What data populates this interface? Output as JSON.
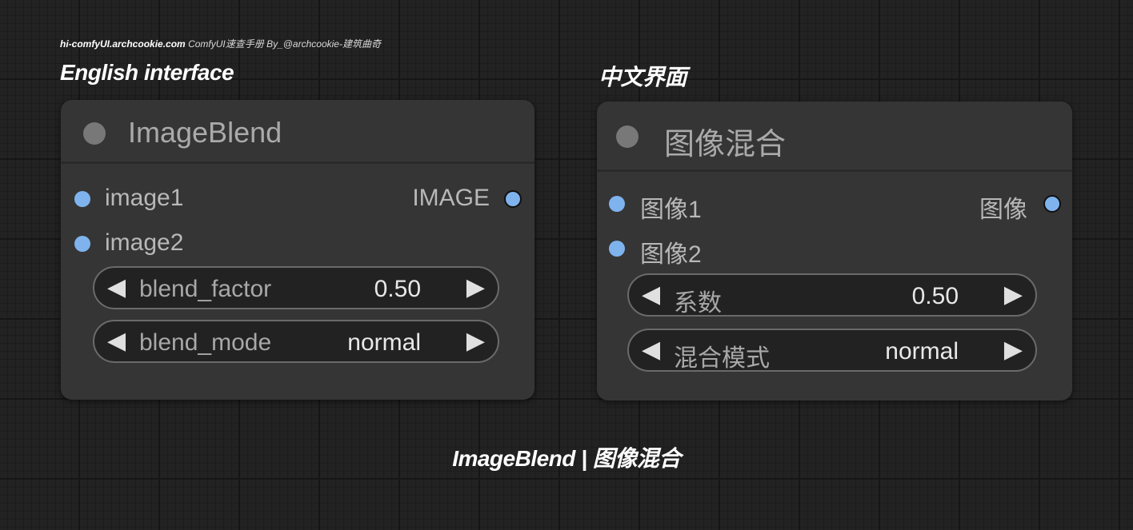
{
  "credit": {
    "site": "hi-comfyUI.archcookie.com",
    "text": "ComfyUI速查手册 By_@archcookie-建筑曲奇"
  },
  "labels": {
    "english": "English interface",
    "chinese": "中文界面"
  },
  "caption": "ImageBlend | 图像混合",
  "nodes": {
    "english": {
      "title": "ImageBlend",
      "inputs": [
        "image1",
        "image2"
      ],
      "output": "IMAGE",
      "widgets": [
        {
          "label": "blend_factor",
          "value": "0.50"
        },
        {
          "label": "blend_mode",
          "value": "normal"
        }
      ]
    },
    "chinese": {
      "title": "图像混合",
      "inputs": [
        "图像1",
        "图像2"
      ],
      "output": "图像",
      "widgets": [
        {
          "label": "系数",
          "value": "0.50"
        },
        {
          "label": "混合模式",
          "value": "normal"
        }
      ]
    }
  },
  "arrows": {
    "left": "◀",
    "right": "▶"
  },
  "colors": {
    "background": "#222222",
    "node_body": "#353535",
    "slot_dot": "#7fb3ed",
    "title_dot": "#787878"
  }
}
